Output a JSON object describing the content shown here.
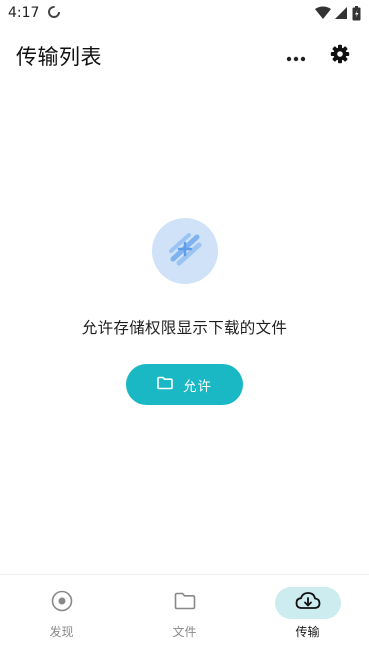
{
  "status_bar": {
    "time": "4:17",
    "icons": [
      "sync-icon",
      "wifi-icon",
      "cell-signal-icon",
      "battery-icon"
    ]
  },
  "header": {
    "title": "传输列表",
    "actions": [
      "more-icon",
      "settings-icon"
    ]
  },
  "empty_state": {
    "message": "允许存储权限显示下载的文件",
    "button_label": "允许",
    "button_icon": "folder-icon"
  },
  "bottom_nav": {
    "items": [
      {
        "label": "发现",
        "icon": "discover-icon",
        "active": false
      },
      {
        "label": "文件",
        "icon": "folder-icon",
        "active": false
      },
      {
        "label": "传输",
        "icon": "cloud-download-icon",
        "active": true
      }
    ]
  },
  "colors": {
    "accent": "#1ab8c4",
    "illustration_bg": "#cfe2f8",
    "active_nav_bg": "#cdecef"
  }
}
